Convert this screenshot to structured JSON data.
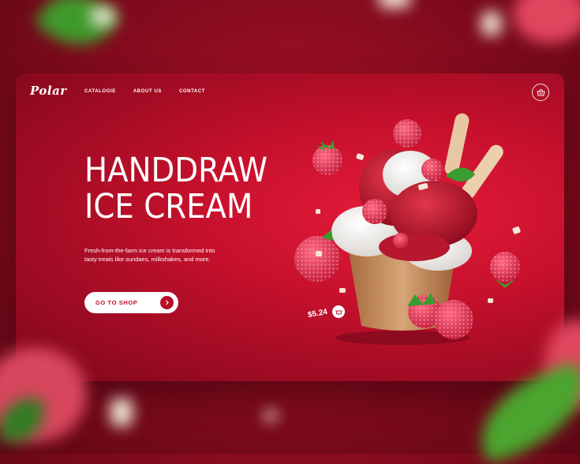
{
  "brand": {
    "logo_text": "Polar"
  },
  "nav": {
    "items": [
      "CATALOGIE",
      "ABOUT US",
      "CONTACT"
    ]
  },
  "hero": {
    "title_line1": "HANDDRAW",
    "title_line2": "ICE CREAM",
    "description": "Fresh-from-the-farm ice cream is transformed into tasty treats like sundaes, milkshakes, and more.",
    "cta_label": "GO TO SHOP"
  },
  "product": {
    "price": "$5.24"
  },
  "icons": [
    "basket-icon",
    "arrow-right-icon",
    "cart-small-icon"
  ],
  "colors": {
    "accent": "#c5102c",
    "dark": "#7c0719",
    "button_bg": "#ffffff",
    "text": "#ffffff"
  }
}
